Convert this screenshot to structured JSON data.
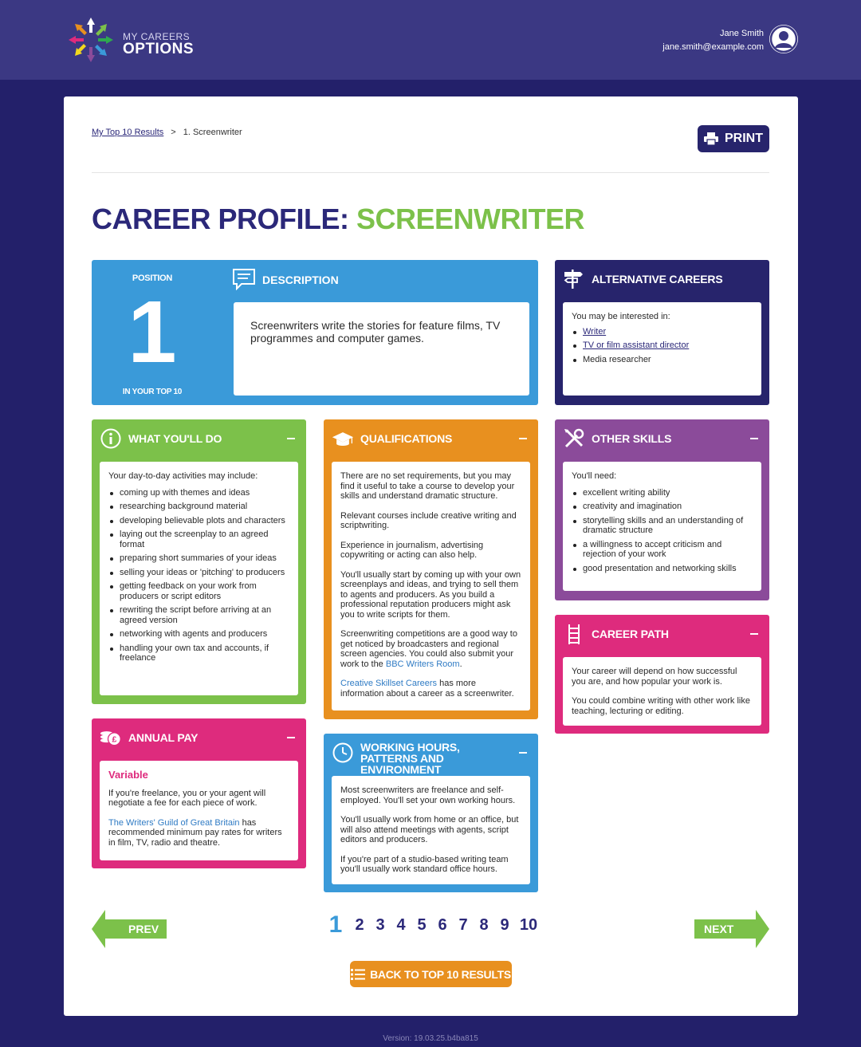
{
  "header": {
    "logo_line1": "MY CAREERS",
    "logo_line2": "OPTIONS",
    "user_name": "Jane Smith",
    "user_email": "jane.smith@example.com"
  },
  "breadcrumb": {
    "parent": "My Top 10 Results",
    "separator": ">",
    "current": "1. Screenwriter"
  },
  "print_label": "PRINT",
  "title": {
    "prefix": "CAREER PROFILE:",
    "career": "SCREENWRITER"
  },
  "position": {
    "label": "POSITION",
    "number": "1",
    "sub": "IN YOUR TOP 10"
  },
  "description": {
    "heading": "DESCRIPTION",
    "text": "Screenwriters write the stories for feature films, TV programmes and computer games."
  },
  "alternative_careers": {
    "heading": "ALTERNATIVE CAREERS",
    "intro": "You may be interested in:",
    "items": [
      {
        "label": "Writer",
        "link": true
      },
      {
        "label": "TV or film assistant director",
        "link": true
      },
      {
        "label": "Media researcher",
        "link": false
      }
    ]
  },
  "what_youll_do": {
    "heading": "WHAT YOU'LL DO",
    "intro": "Your day-to-day activities may include:",
    "items": [
      "coming up with themes and ideas",
      "researching background material",
      "developing believable plots and characters",
      "laying out the screenplay to an agreed format",
      "preparing short summaries of your ideas",
      "selling your ideas or 'pitching' to producers",
      "getting feedback on your work from producers or script editors",
      "rewriting the script before arriving at an agreed version",
      "networking with agents and producers",
      "handling your own tax and accounts, if freelance"
    ]
  },
  "qualifications": {
    "heading": "QUALIFICATIONS",
    "p1": "There are no set requirements, but you may find it useful to take a course to develop your skills and understand dramatic structure.",
    "p2": "Relevant courses include creative writing and scriptwriting.",
    "p3": "Experience in journalism, advertising copywriting or acting can also help.",
    "p4": "You'll usually start by coming up with your own screenplays and ideas, and trying to sell them to agents and producers. As you build a professional reputation producers might ask you to write scripts for them.",
    "p5_text": "Screenwriting competitions are a good way to get noticed by broadcasters and regional screen agencies. You could also submit your work to the ",
    "p5_link": "BBC Writers Room",
    "p5_end": ".",
    "p6_link": "Creative Skillset Careers",
    "p6_text": " has more information about a career as a screenwriter."
  },
  "other_skills": {
    "heading": "OTHER SKILLS",
    "intro": "You'll need:",
    "items": [
      "excellent writing ability",
      "creativity and imagination",
      "storytelling skills and an understanding of dramatic structure",
      "a willingness to accept criticism and rejection of your work",
      "good presentation and networking skills"
    ]
  },
  "career_path": {
    "heading": "CAREER PATH",
    "p1": "Your career will depend on how successful you are, and how popular your work is.",
    "p2": "You could combine writing with other work like teaching, lecturing or editing."
  },
  "annual_pay": {
    "heading": "ANNUAL PAY",
    "amount": "Variable",
    "p1": "If you're freelance, you or your agent will negotiate a fee for each piece of work.",
    "p2_link": "The Writers' Guild of Great Britain",
    "p2_text": " has recommended minimum pay rates for writers in film, TV, radio and theatre."
  },
  "working_hours": {
    "heading": "WORKING HOURS, PATTERNS AND ENVIRONMENT",
    "p1": "Most screenwriters are freelance and self-employed. You'll set your own working hours.",
    "p2": "You'll usually work from home or an office, but will also attend meetings with agents, script editors and producers.",
    "p3": "If you're part of a studio-based writing team you'll usually work standard office hours."
  },
  "navigation": {
    "prev": "PREV",
    "next": "NEXT",
    "pages": [
      "1",
      "2",
      "3",
      "4",
      "5",
      "6",
      "7",
      "8",
      "9",
      "10"
    ],
    "current_page": "1",
    "back_label": "BACK TO TOP 10 RESULTS"
  },
  "version": "Version: 19.03.25.b4ba815",
  "colors": {
    "background": "#23206a",
    "header": "#3b3883",
    "navy": "#2b2879",
    "green": "#7cc14a",
    "blue": "#3a9ad9",
    "orange": "#e8901f",
    "purple": "#8b4b9a",
    "pink": "#de2b7d"
  },
  "icons": [
    "user-avatar-icon",
    "printer-icon",
    "speech-bubble-icon",
    "signpost-icon",
    "info-icon",
    "graduation-cap-icon",
    "tools-icon",
    "ladder-icon",
    "coins-icon",
    "clock-icon",
    "list-icon",
    "left-arrow-icon",
    "right-arrow-icon"
  ]
}
